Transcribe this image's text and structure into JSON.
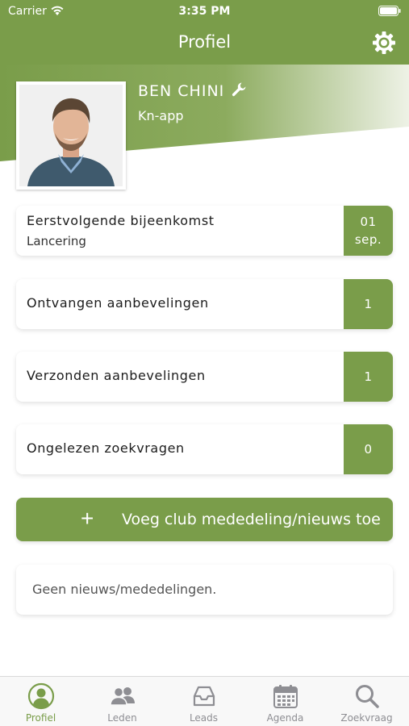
{
  "status_bar": {
    "carrier": "Carrier",
    "time": "3:35 PM"
  },
  "nav": {
    "title": "Profiel"
  },
  "profile": {
    "name": "BEN CHINI",
    "company": "Kn-app"
  },
  "cards": [
    {
      "label": "Eerstvolgende bijeenkomst",
      "sublabel": "Lancering",
      "badge_line1": "01",
      "badge_line2": "sep."
    },
    {
      "label": "Ontvangen aanbevelingen",
      "badge": "1"
    },
    {
      "label": "Verzonden aanbevelingen",
      "badge": "1"
    },
    {
      "label": "Ongelezen zoekvragen",
      "badge": "0"
    }
  ],
  "add_button": {
    "plus": "+",
    "label": "Voeg club mededeling/nieuws toe"
  },
  "news": {
    "empty_text": "Geen nieuws/mededelingen."
  },
  "tabs": [
    {
      "label": "Profiel",
      "icon": "profile-icon",
      "active": true
    },
    {
      "label": "Leden",
      "icon": "members-icon"
    },
    {
      "label": "Leads",
      "icon": "inbox-icon"
    },
    {
      "label": "Agenda",
      "icon": "calendar-icon"
    },
    {
      "label": "Zoekvraag",
      "icon": "search-icon"
    }
  ],
  "colors": {
    "accent": "#7a9d4a",
    "inactive": "#8e8e93"
  }
}
